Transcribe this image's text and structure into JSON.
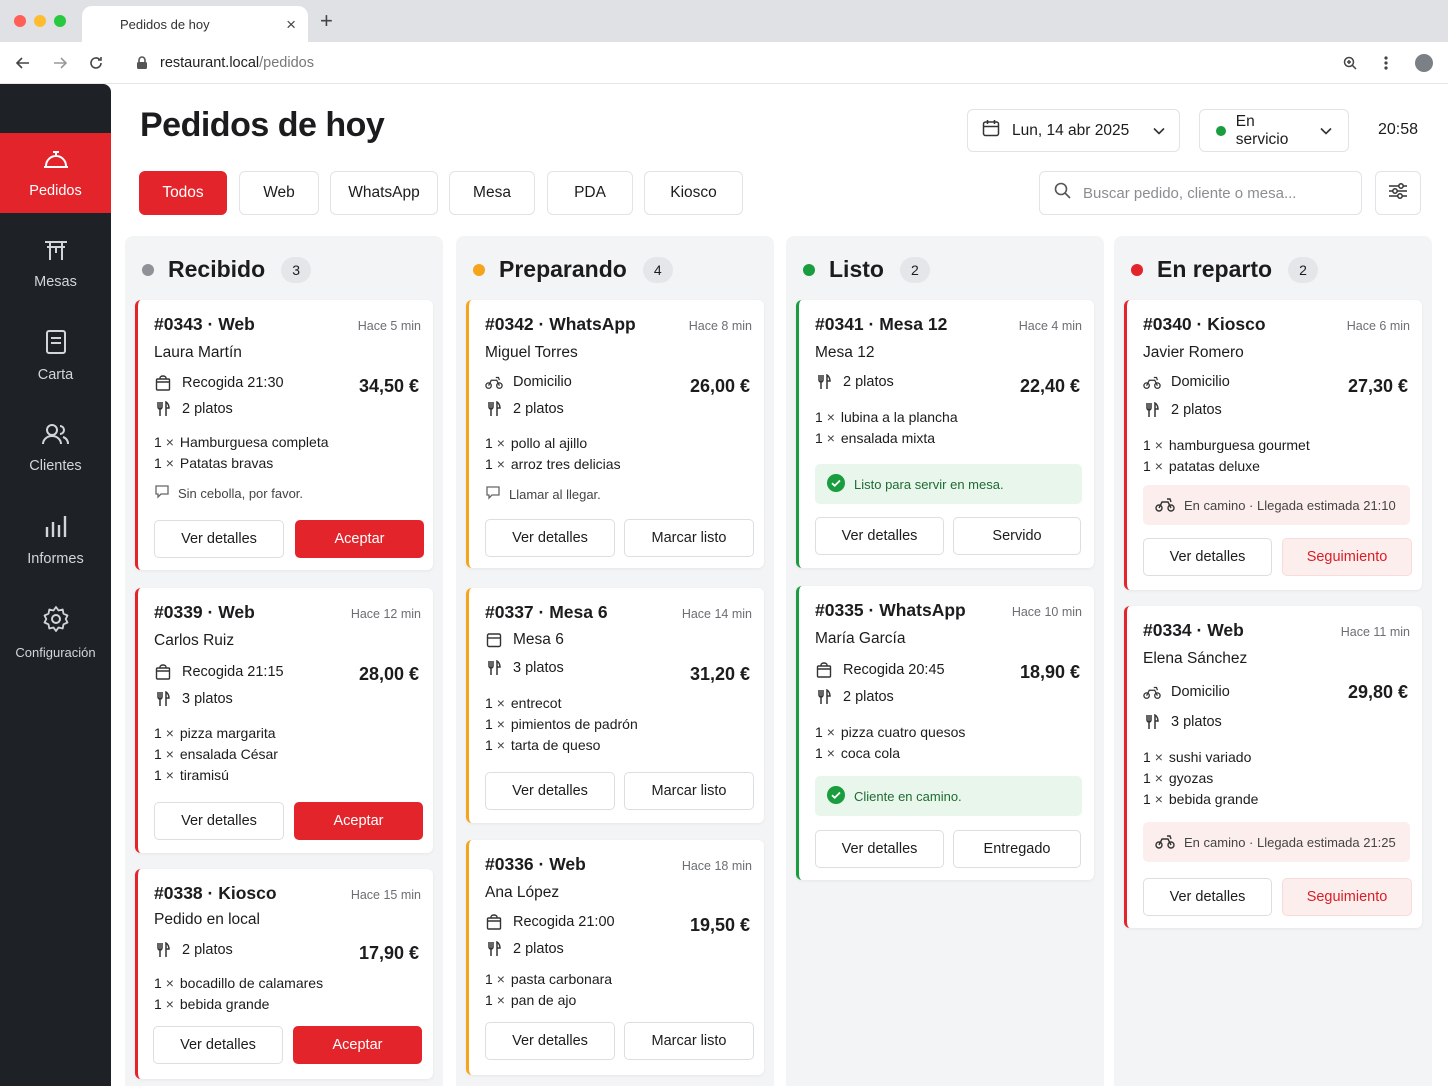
{
  "browser": {
    "tab_title": "Pedidos de hoy",
    "url_host": "restaurant.local",
    "url_path": "/pedidos"
  },
  "sidebar": {
    "items": [
      {
        "label": "Pedidos",
        "icon": "bell-icon",
        "active": true
      },
      {
        "label": "Mesas",
        "icon": "table-icon"
      },
      {
        "label": "Carta",
        "icon": "menu-icon"
      },
      {
        "label": "Clientes",
        "icon": "users-icon"
      },
      {
        "label": "Informes",
        "icon": "bar-chart-icon"
      },
      {
        "label": "Configuración",
        "icon": "gear-icon"
      }
    ]
  },
  "header": {
    "title": "Pedidos de hoy",
    "date": "Lun, 14 abr 2025",
    "status": "En servicio",
    "clock": "20:58"
  },
  "filters": [
    "Todos",
    "Web",
    "WhatsApp",
    "Mesa",
    "PDA",
    "Kiosco"
  ],
  "search": {
    "placeholder": "Buscar pedido, cliente o mesa..."
  },
  "columns": [
    {
      "title": "Recibido",
      "count": "3",
      "dot_color": "#8e9196",
      "accent": "#e3242b",
      "cards": [
        {
          "id": "#0343 · Web",
          "time": "Hace 5 min",
          "name": "Laura Martín",
          "price": "34,50 €",
          "meta": [
            {
              "icon": "bag-icon",
              "text": "Recogida 21:30"
            },
            {
              "icon": "cutlery-icon",
              "text": "2 platos"
            }
          ],
          "items": [
            "Hamburguesa completa",
            "Patatas bravas"
          ],
          "note": "Sin cebolla, por favor.",
          "actions": [
            "Ver detalles",
            "Aceptar"
          ]
        },
        {
          "id": "#0339 · Web",
          "time": "Hace 12 min",
          "name": "Carlos Ruiz",
          "price": "28,00 €",
          "meta": [
            {
              "icon": "bag-icon",
              "text": "Recogida 21:15"
            },
            {
              "icon": "cutlery-icon",
              "text": "3 platos"
            }
          ],
          "items": [
            "pizza margarita",
            "ensalada César",
            "tiramisú"
          ],
          "actions": [
            "Ver detalles",
            "Aceptar"
          ]
        },
        {
          "id": "#0338 · Kiosco",
          "time": "Hace 15 min",
          "name": "Pedido en local",
          "price": "17,90 €",
          "meta": [
            {
              "icon": "cutlery-icon",
              "text": "2 platos"
            }
          ],
          "items": [
            "bocadillo de calamares",
            "bebida grande"
          ],
          "actions": [
            "Ver detalles",
            "Aceptar"
          ]
        }
      ]
    },
    {
      "title": "Preparando",
      "count": "4",
      "dot_color": "#f4a51c",
      "accent": "#f4a51c",
      "cards": [
        {
          "id": "#0342 · WhatsApp",
          "time": "Hace 8 min",
          "name": "Miguel Torres",
          "price": "26,00 €",
          "meta": [
            {
              "icon": "scooter-icon",
              "text": "Domicilio"
            },
            {
              "icon": "cutlery-icon",
              "text": "2 platos"
            }
          ],
          "items": [
            "pollo al ajillo",
            "arroz tres delicias"
          ],
          "note": "Llamar al llegar.",
          "actions": [
            "Ver detalles",
            "Marcar listo"
          ]
        },
        {
          "id": "#0337 · Mesa 6",
          "time": "Hace 14 min",
          "name": "",
          "price": "31,20 €",
          "meta": [
            {
              "icon": "table-square-icon",
              "text": "Mesa 6"
            },
            {
              "icon": "cutlery-icon",
              "text": "3 platos"
            }
          ],
          "items": [
            "entrecot",
            "pimientos de padrón",
            "tarta de queso"
          ],
          "actions": [
            "Ver detalles",
            "Marcar listo"
          ]
        },
        {
          "id": "#0336 · Web",
          "time": "Hace 18 min",
          "name": "Ana López",
          "price": "19,50 €",
          "meta": [
            {
              "icon": "bag-icon",
              "text": "Recogida 21:00"
            },
            {
              "icon": "cutlery-icon",
              "text": "2 platos"
            }
          ],
          "items": [
            "pasta carbonara",
            "pan de ajo"
          ],
          "actions": [
            "Ver detalles",
            "Marcar listo"
          ]
        }
      ]
    },
    {
      "title": "Listo",
      "count": "2",
      "dot_color": "#1a9d3f",
      "accent": "#1a9d3f",
      "cards": [
        {
          "id": "#0341 · Mesa 12",
          "time": "Hace 4 min",
          "name": "Mesa 12",
          "price": "22,40 €",
          "meta": [
            {
              "icon": "cutlery-icon",
              "text": "2 platos"
            }
          ],
          "items": [
            "lubina a la plancha",
            "ensalada mixta"
          ],
          "banner": "Listo para servir en mesa.",
          "actions": [
            "Ver detalles",
            "Servido"
          ]
        },
        {
          "id": "#0335 · WhatsApp",
          "time": "Hace 10 min",
          "name": "María García",
          "price": "18,90 €",
          "meta": [
            {
              "icon": "bag-icon",
              "text": "Recogida 20:45"
            },
            {
              "icon": "cutlery-icon",
              "text": "2 platos"
            }
          ],
          "items": [
            "pizza cuatro quesos",
            "coca cola"
          ],
          "banner": "Cliente en camino.",
          "actions": [
            "Ver detalles",
            "Entregado"
          ]
        }
      ]
    },
    {
      "title": "En reparto",
      "count": "2",
      "dot_color": "#e3242b",
      "accent": "#e3242b",
      "cards": [
        {
          "id": "#0340 · Kiosco",
          "time": "Hace 6 min",
          "name": "Javier Romero",
          "price": "27,30 €",
          "meta": [
            {
              "icon": "scooter-icon",
              "text": "Domicilio"
            },
            {
              "icon": "cutlery-icon",
              "text": "2 platos"
            }
          ],
          "items": [
            "hamburguesa gourmet",
            "patatas deluxe"
          ],
          "banner": "En camino · Llegada estimada 21:10",
          "actions": [
            "Ver detalles",
            "Seguimiento"
          ]
        },
        {
          "id": "#0334 · Web",
          "time": "Hace 11 min",
          "name": "Elena Sánchez",
          "price": "29,80 €",
          "meta": [
            {
              "icon": "scooter-icon",
              "text": "Domicilio"
            },
            {
              "icon": "cutlery-icon",
              "text": "3 platos"
            }
          ],
          "items": [
            "sushi variado",
            "gyozas",
            "bebida grande"
          ],
          "banner": "En camino · Llegada estimada 21:25",
          "actions": [
            "Ver detalles",
            "Seguimiento"
          ]
        }
      ]
    }
  ],
  "item_qty": "1"
}
